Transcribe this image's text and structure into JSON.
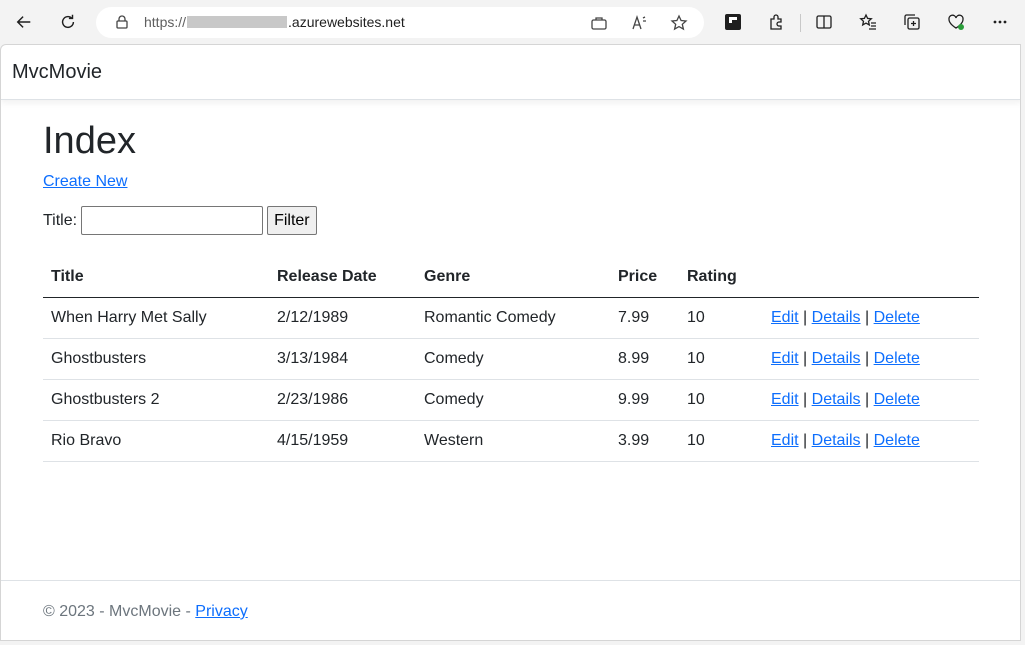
{
  "browser": {
    "url_prefix": "https://",
    "url_suffix": ".azurewebsites.net",
    "icons": [
      "back-icon",
      "refresh-icon",
      "lock-icon",
      "app-available-icon",
      "read-aloud-icon",
      "favorite-star-icon",
      "flipboard-extension-icon",
      "extensions-icon",
      "split-screen-icon",
      "favorites-icon",
      "collections-icon",
      "browser-essentials-icon",
      "more-menu-icon"
    ]
  },
  "navbar": {
    "brand": "MvcMovie"
  },
  "main": {
    "title": "Index",
    "create_link": "Create New",
    "filter": {
      "label": "Title:",
      "value": "",
      "button": "Filter"
    },
    "table": {
      "headers": [
        "Title",
        "Release Date",
        "Genre",
        "Price",
        "Rating",
        ""
      ],
      "rows": [
        {
          "title": "When Harry Met Sally",
          "release_date": "2/12/1989",
          "genre": "Romantic Comedy",
          "price": "7.99",
          "rating": "10"
        },
        {
          "title": "Ghostbusters",
          "release_date": "3/13/1984",
          "genre": "Comedy",
          "price": "8.99",
          "rating": "10"
        },
        {
          "title": "Ghostbusters 2",
          "release_date": "2/23/1986",
          "genre": "Comedy",
          "price": "9.99",
          "rating": "10"
        },
        {
          "title": "Rio Bravo",
          "release_date": "4/15/1959",
          "genre": "Western",
          "price": "3.99",
          "rating": "10"
        }
      ],
      "actions": {
        "edit": "Edit",
        "details": "Details",
        "delete": "Delete",
        "separator": "|"
      }
    }
  },
  "footer": {
    "text": "© 2023 - MvcMovie -",
    "privacy": "Privacy"
  },
  "colors": {
    "link": "#0d6efd",
    "text": "#212529",
    "muted": "#6c757d"
  }
}
